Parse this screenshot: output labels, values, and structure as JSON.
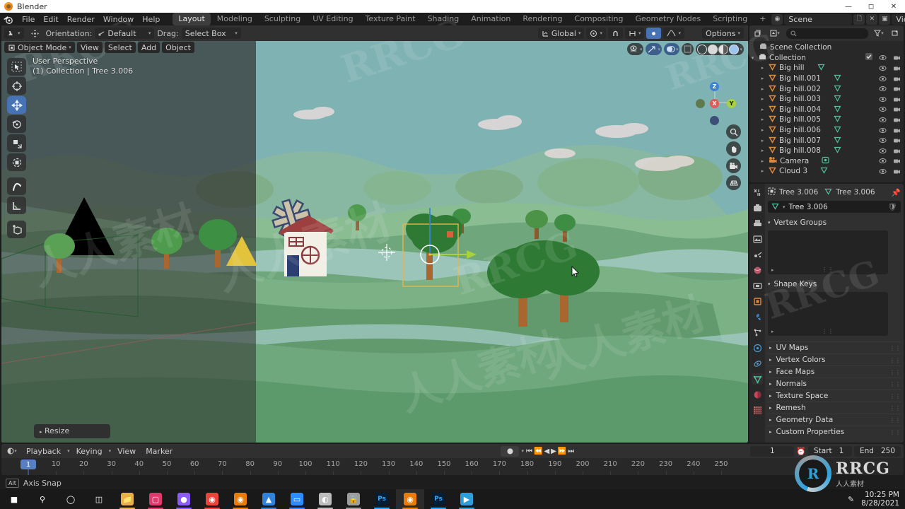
{
  "window": {
    "title": "Blender",
    "icon": "blender-icon",
    "buttons": [
      "minimize",
      "maximize",
      "close"
    ]
  },
  "topbar": {
    "logo": "blender-logo-icon",
    "menus": [
      "File",
      "Edit",
      "Render",
      "Window",
      "Help"
    ],
    "workspaces": [
      {
        "label": "Layout",
        "active": true
      },
      {
        "label": "Modeling",
        "active": false
      },
      {
        "label": "Sculpting",
        "active": false
      },
      {
        "label": "UV Editing",
        "active": false
      },
      {
        "label": "Texture Paint",
        "active": false
      },
      {
        "label": "Shading",
        "active": false
      },
      {
        "label": "Animation",
        "active": false
      },
      {
        "label": "Rendering",
        "active": false
      },
      {
        "label": "Compositing",
        "active": false
      },
      {
        "label": "Geometry Nodes",
        "active": false
      },
      {
        "label": "Scripting",
        "active": false
      }
    ],
    "add_workspace": "+",
    "scene_name": "Scene",
    "view_layer_name": "View Layer"
  },
  "viewport": {
    "header": {
      "orientation_label": "Orientation:",
      "orientation_value": "Default",
      "drag_label": "Drag:",
      "drag_value": "Select Box",
      "transform_orientation": "Global",
      "options_label": "Options"
    },
    "header2": {
      "mode": "Object Mode",
      "menus": [
        "View",
        "Select",
        "Add",
        "Object"
      ]
    },
    "overlay": {
      "line1": "User Perspective",
      "line2": "(1) Collection | Tree 3.006"
    },
    "tools": [
      "tweak-select-tool",
      "cursor-tool",
      "move-tool",
      "rotate-tool",
      "scale-tool",
      "transform-tool",
      "annotate-tool",
      "measure-tool",
      "add-cube-tool"
    ],
    "nav_buttons": [
      "zoom-icon",
      "hand-pan-icon",
      "camera-view-icon",
      "ortho-persp-icon"
    ],
    "gizmo_axes": [
      {
        "label": "X",
        "color": "#e05a55"
      },
      {
        "label": "Y",
        "color": "#a8d13c"
      },
      {
        "label": "Z",
        "color": "#3b82d6"
      }
    ],
    "status_operator": "Resize",
    "colors": {
      "sky": "#7fb2b2",
      "grass_light": "#8ec190",
      "grass_mid": "#6ba173",
      "grass_dark": "#4c7f57",
      "tree_dark": "#2f6b34",
      "trunk": "#a9662f",
      "selection_outline": "#e8b44a",
      "gizmo_x": "#e05a55",
      "gizmo_y": "#a8d13c",
      "gizmo_z": "#3b82d6"
    }
  },
  "outliner": {
    "display_mode_icon": "view-layer-icon",
    "filter_icon": "filter-icon",
    "new_collection_icon": "new-collection-icon",
    "search_placeholder": "",
    "root": "Scene Collection",
    "collection": "Collection",
    "items": [
      {
        "name": "Big hill",
        "type": "mesh",
        "indent": 2
      },
      {
        "name": "Big hill.001",
        "type": "mesh",
        "indent": 2
      },
      {
        "name": "Big hill.002",
        "type": "mesh",
        "indent": 2
      },
      {
        "name": "Big hill.003",
        "type": "mesh",
        "indent": 2
      },
      {
        "name": "Big hill.004",
        "type": "mesh",
        "indent": 2
      },
      {
        "name": "Big hill.005",
        "type": "mesh",
        "indent": 2
      },
      {
        "name": "Big hill.006",
        "type": "mesh",
        "indent": 2
      },
      {
        "name": "Big hill.007",
        "type": "mesh",
        "indent": 2
      },
      {
        "name": "Big hill.008",
        "type": "mesh",
        "indent": 2
      },
      {
        "name": "Camera",
        "type": "camera",
        "indent": 2
      },
      {
        "name": "Cloud 3",
        "type": "mesh",
        "indent": 2
      }
    ]
  },
  "properties": {
    "tabs": [
      "tool-icon",
      "render-icon",
      "output-icon",
      "view-layer-icon",
      "scene-icon",
      "world-icon",
      "collection-icon",
      "object-icon",
      "modifier-icon",
      "particles-icon",
      "physics-icon",
      "constraints-icon",
      "object-data-icon",
      "material-icon",
      "texture-icon"
    ],
    "active_tab_index": 12,
    "breadcrumb_object": "Tree 3.006",
    "breadcrumb_data": "Tree 3.006",
    "name_field": "Tree 3.006",
    "panels": [
      {
        "label": "Vertex Groups",
        "open": true
      },
      {
        "label": "Shape Keys",
        "open": true
      }
    ],
    "collapsed_panels": [
      "UV Maps",
      "Vertex Colors",
      "Face Maps",
      "Normals",
      "Texture Space",
      "Remesh",
      "Geometry Data",
      "Custom Properties"
    ]
  },
  "timeline": {
    "playback_label": "Playback",
    "keying_label": "Keying",
    "view_label": "View",
    "marker_label": "Marker",
    "current_frame": "1",
    "start_label": "Start",
    "start_value": "1",
    "end_label": "End",
    "end_value": "250",
    "ticks": [
      10,
      20,
      30,
      40,
      50,
      60,
      70,
      80,
      90,
      100,
      110,
      120,
      130,
      140,
      150,
      160,
      170,
      180,
      190,
      200,
      210,
      220,
      230,
      240,
      250
    ],
    "playhead_frame": 1,
    "transport_icons": [
      "jump-start-icon",
      "prev-keyframe-icon",
      "play-reverse-icon",
      "play-icon",
      "next-keyframe-icon",
      "jump-end-icon"
    ],
    "record_icon": "record-icon"
  },
  "statusbar": {
    "key_hint": "Alt",
    "hint_text": "Axis Snap"
  },
  "taskbar": {
    "items": [
      {
        "name": "start-button",
        "icon": "windows-logo-icon",
        "color": "#0a84ff"
      },
      {
        "name": "search-button",
        "icon": "search-icon",
        "color": "#ffffff"
      },
      {
        "name": "cortana-button",
        "icon": "cortana-icon",
        "color": "#ffffff"
      },
      {
        "name": "task-view-button",
        "icon": "task-view-icon",
        "color": "#ffffff"
      },
      {
        "name": "file-explorer",
        "icon": "folder-icon",
        "color": "#e8b04b"
      },
      {
        "name": "app-instagram",
        "icon": "instagram-icon",
        "color": "#dd3b6e"
      },
      {
        "name": "app-firefox-dev",
        "icon": "firefox-icon",
        "color": "#8b5cf6"
      },
      {
        "name": "app-chrome",
        "icon": "chrome-icon",
        "color": "#e8453c"
      },
      {
        "name": "app-blender",
        "icon": "blender-icon",
        "color": "#e87d0d"
      },
      {
        "name": "app-editor",
        "icon": "editor-icon",
        "color": "#2f83d8"
      },
      {
        "name": "app-zoom",
        "icon": "zoom-app-icon",
        "color": "#2d8cff"
      },
      {
        "name": "app-media",
        "icon": "media-icon",
        "color": "#bdbdbd"
      },
      {
        "name": "app-lock",
        "icon": "lock-icon",
        "color": "#9e9e9e"
      },
      {
        "name": "app-photoshop",
        "icon": "photoshop-icon",
        "color": "#31a8ff"
      },
      {
        "name": "app-blender-active",
        "icon": "blender-icon",
        "color": "#e87d0d"
      },
      {
        "name": "app-photoshop-2",
        "icon": "photoshop-icon",
        "color": "#31a8ff"
      },
      {
        "name": "app-video-player",
        "icon": "video-player-icon",
        "color": "#2f9ed8"
      }
    ],
    "tray_icon": "pen-icon",
    "time": "10:25 PM",
    "date": "8/28/2021"
  },
  "watermarks": {
    "brand": "RRCG",
    "chinese": "人人素材"
  }
}
